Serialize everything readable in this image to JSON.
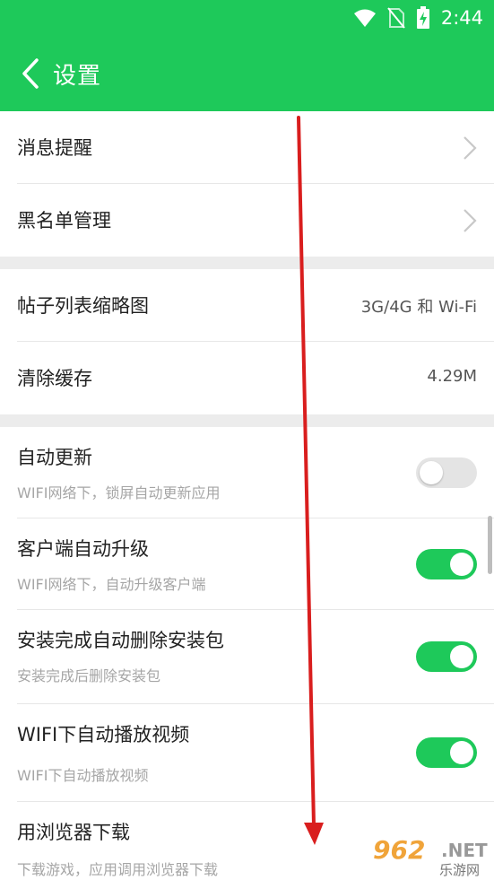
{
  "status_bar": {
    "time": "2:44",
    "icons": [
      "wifi-icon",
      "no-sim-icon",
      "battery-charging-icon"
    ]
  },
  "app_bar": {
    "back_icon": "chevron-left-icon",
    "title": "设置"
  },
  "sections": {
    "notifications": {
      "message_reminder": "消息提醒",
      "blacklist": "黑名单管理"
    },
    "display": {
      "thumbnail_label": "帖子列表缩略图",
      "thumbnail_value": "3G/4G 和 Wi-Fi",
      "cache_label": "清除缓存",
      "cache_value": "4.29M"
    },
    "updates": [
      {
        "title": "自动更新",
        "desc": "WIFI网络下，锁屏自动更新应用",
        "on": false
      },
      {
        "title": "客户端自动升级",
        "desc": "WIFI网络下，自动升级客户端",
        "on": true
      },
      {
        "title": "安装完成自动删除安装包",
        "desc": "安装完成后删除安装包",
        "on": true
      },
      {
        "title": "WIFI下自动播放视频",
        "desc": "WIFI下自动播放视频",
        "on": true
      },
      {
        "title": "用浏览器下载",
        "desc": "下载游戏，应用调用浏览器下载"
      }
    ]
  },
  "colors": {
    "accent": "#1ec95a",
    "toggle_off": "#e4e4e4",
    "arrow": "#d91e1e",
    "watermark": "#f0a43a"
  },
  "watermark": {
    "logo": "962",
    "suffix": ".NET",
    "cn": "乐游网"
  }
}
